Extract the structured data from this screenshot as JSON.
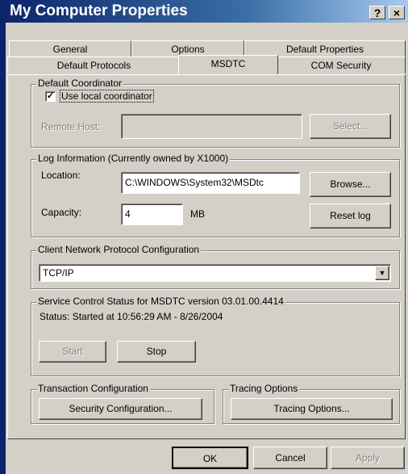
{
  "window": {
    "title": "My Computer Properties",
    "help_button": "?",
    "close_button": "×"
  },
  "tabs": {
    "row1": [
      "General",
      "Options",
      "Default Properties"
    ],
    "row2": [
      "Default Protocols",
      "MSDTC",
      "COM Security"
    ],
    "active": "MSDTC"
  },
  "default_coordinator": {
    "group_label": "Default Coordinator",
    "use_local_label": "Use local coordinator",
    "use_local_checked": true,
    "remote_host_label": "Remote Host:",
    "remote_host_value": "",
    "select_button": "Select..."
  },
  "log_info": {
    "group_label": "Log Information (Currently owned by X1000)",
    "location_label": "Location:",
    "location_value": "C:\\WINDOWS\\System32\\MSDtc",
    "browse_button": "Browse...",
    "capacity_label": "Capacity:",
    "capacity_value": "4",
    "capacity_unit": "MB",
    "reset_button": "Reset log"
  },
  "client_network": {
    "group_label": "Client Network Protocol Configuration",
    "selected_value": "TCP/IP"
  },
  "service_status": {
    "group_label": "Service Control Status for MSDTC version 03.01.00.4414",
    "status_text": "Status: Started at 10:56:29 AM - 8/26/2004",
    "start_button": "Start",
    "stop_button": "Stop"
  },
  "transaction_config": {
    "group_label": "Transaction Configuration",
    "security_button": "Security Configuration..."
  },
  "tracing": {
    "group_label": "Tracing Options",
    "tracing_button": "Tracing Options..."
  },
  "footer": {
    "ok": "OK",
    "cancel": "Cancel",
    "apply": "Apply"
  }
}
